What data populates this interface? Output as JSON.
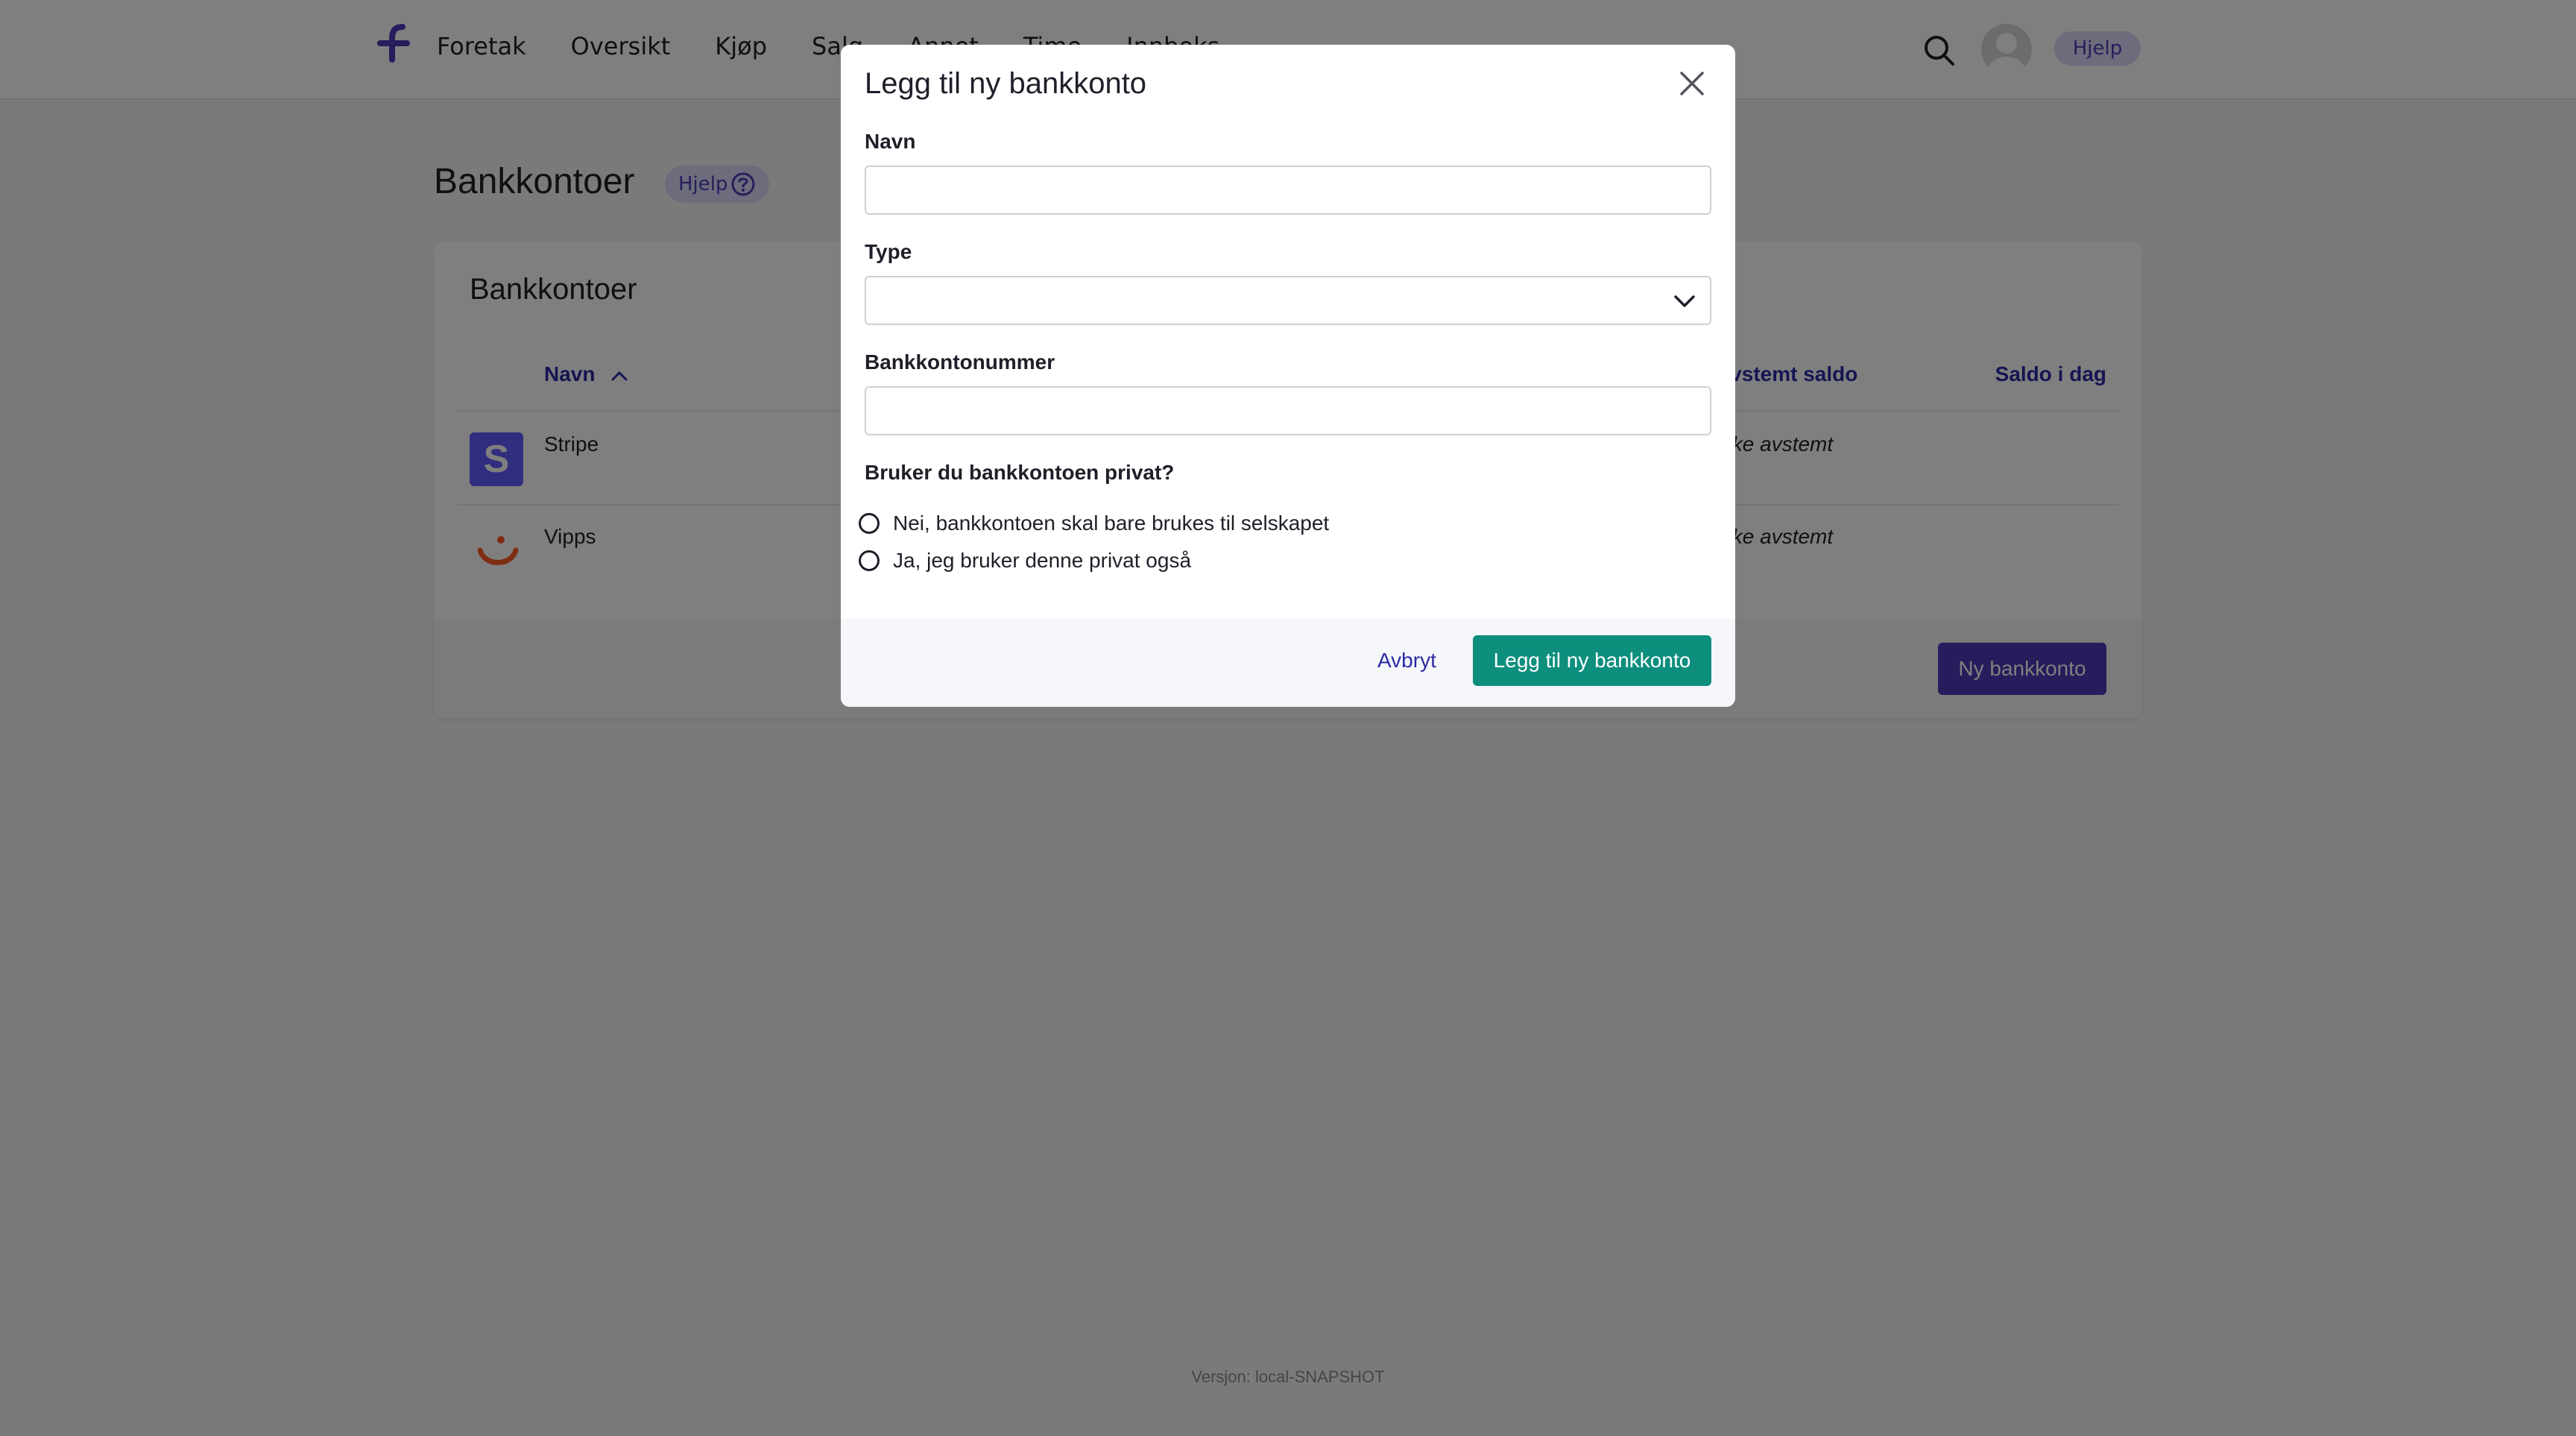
{
  "topbar": {
    "nav": [
      "Foretak",
      "Oversikt",
      "Kjøp",
      "Salg",
      "Annet",
      "Time",
      "Innboks"
    ],
    "help_label": "Hjelp",
    "brand_color": "#4b3bb8"
  },
  "page": {
    "title": "Bankkontoer",
    "help_label": "Hjelp"
  },
  "card": {
    "title": "Bankkontoer",
    "columns": {
      "name": "Navn",
      "reconciled_balance": "Avstemt saldo",
      "balance_today": "Saldo i dag"
    },
    "rows": [
      {
        "name": "Stripe",
        "status": "Ikke avstemt",
        "logo": "stripe-logo"
      },
      {
        "name": "Vipps",
        "status": "Ikke avstemt",
        "logo": "vipps-logo"
      }
    ],
    "new_account_label": "Ny bankkonto"
  },
  "footer": {
    "version": "Versjon: local-SNAPSHOT"
  },
  "modal": {
    "title": "Legg til ny bankkonto",
    "name_label": "Navn",
    "name_value": "",
    "type_label": "Type",
    "type_value": "",
    "account_number_label": "Bankkontonummer",
    "account_number_value": "",
    "private_question": "Bruker du bankkontoen privat?",
    "options": [
      "Nei, bankkontoen skal bare brukes til selskapet",
      "Ja, jeg bruker denne privat også"
    ],
    "cancel_label": "Avbryt",
    "submit_label": "Legg til ny bankkonto",
    "submit_color": "#0e8f7e"
  }
}
